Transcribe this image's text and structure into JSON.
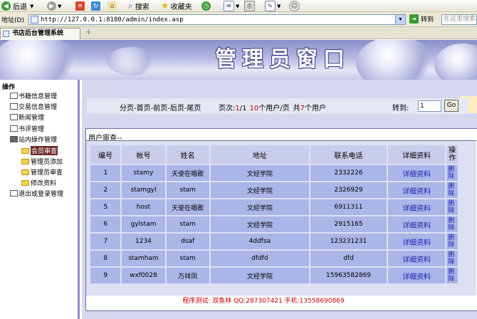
{
  "toolbar": {
    "back_label": "后退",
    "search_label": "搜索",
    "favorites_label": "收藏夹"
  },
  "addressbar": {
    "label": "地址(D)",
    "url": "http://127.0.0.1:8180/admin/index.asp",
    "go_label": "转到",
    "search_placeholder": "在这里搜索"
  },
  "tab": {
    "title": "书店后台管理系统"
  },
  "banner": {
    "title": "管理员窗口"
  },
  "sidebar": {
    "root": "操作",
    "items": [
      {
        "label": "书籍信息管理"
      },
      {
        "label": "交易信息管理"
      },
      {
        "label": "新闻管理"
      },
      {
        "label": "书评管理"
      },
      {
        "label": "站内操作管理"
      },
      {
        "label": "会员审查",
        "selected": true
      },
      {
        "label": "管理员添加"
      },
      {
        "label": "管理员审查"
      },
      {
        "label": "修改资料"
      },
      {
        "label": "退出或登录管理"
      }
    ]
  },
  "pager": {
    "nav": "分页-首页-前页-后页-尾页",
    "page_prefix": "页次:",
    "page_current": "1",
    "page_sep": "/1",
    "per_page_num": "10",
    "per_page_suffix": "个用户/页",
    "total_prefix": "共",
    "total_num": "7",
    "total_suffix": "个用户",
    "goto_label": "转到:",
    "goto_value": "1",
    "go_button": "Go"
  },
  "panel": {
    "title": "用户审查--"
  },
  "table": {
    "headers": [
      "编号",
      "帐号",
      "姓名",
      "地址",
      "联系电话",
      "详细资料",
      "操作"
    ],
    "rows": [
      {
        "id": "1",
        "account": "stamy",
        "name": "天使在唱歌",
        "address": "文经学院",
        "phone": "2332226",
        "detail": "详细资料",
        "op": "删除"
      },
      {
        "id": "2",
        "account": "stamgyl",
        "name": "stam",
        "address": "文经学院",
        "phone": "2326929",
        "detail": "详细资料",
        "op": "删除"
      },
      {
        "id": "5",
        "account": "host",
        "name": "天使在唱歌",
        "address": "文经学院",
        "phone": "6911311",
        "detail": "详细资料",
        "op": "删除"
      },
      {
        "id": "6",
        "account": "gylstam",
        "name": "stam",
        "address": "文经学院",
        "phone": "2915165",
        "detail": "详细资料",
        "op": "删除"
      },
      {
        "id": "7",
        "account": "1234",
        "name": "dsaf",
        "address": "4ddfsa",
        "phone": "123231231",
        "detail": "详细资料",
        "op": "删除"
      },
      {
        "id": "8",
        "account": "stamham",
        "name": "stam",
        "address": "dfdfd",
        "phone": "dfd",
        "detail": "详细资料",
        "op": "删除"
      },
      {
        "id": "9",
        "account": "wxf0028",
        "name": "万祥凤",
        "address": "文经学院",
        "phone": "15963582869",
        "detail": "详细资料",
        "op": "删除"
      }
    ]
  },
  "footer": {
    "text": "程序测试: 双鱼林 QQ:287307421 手机:13558690869"
  }
}
